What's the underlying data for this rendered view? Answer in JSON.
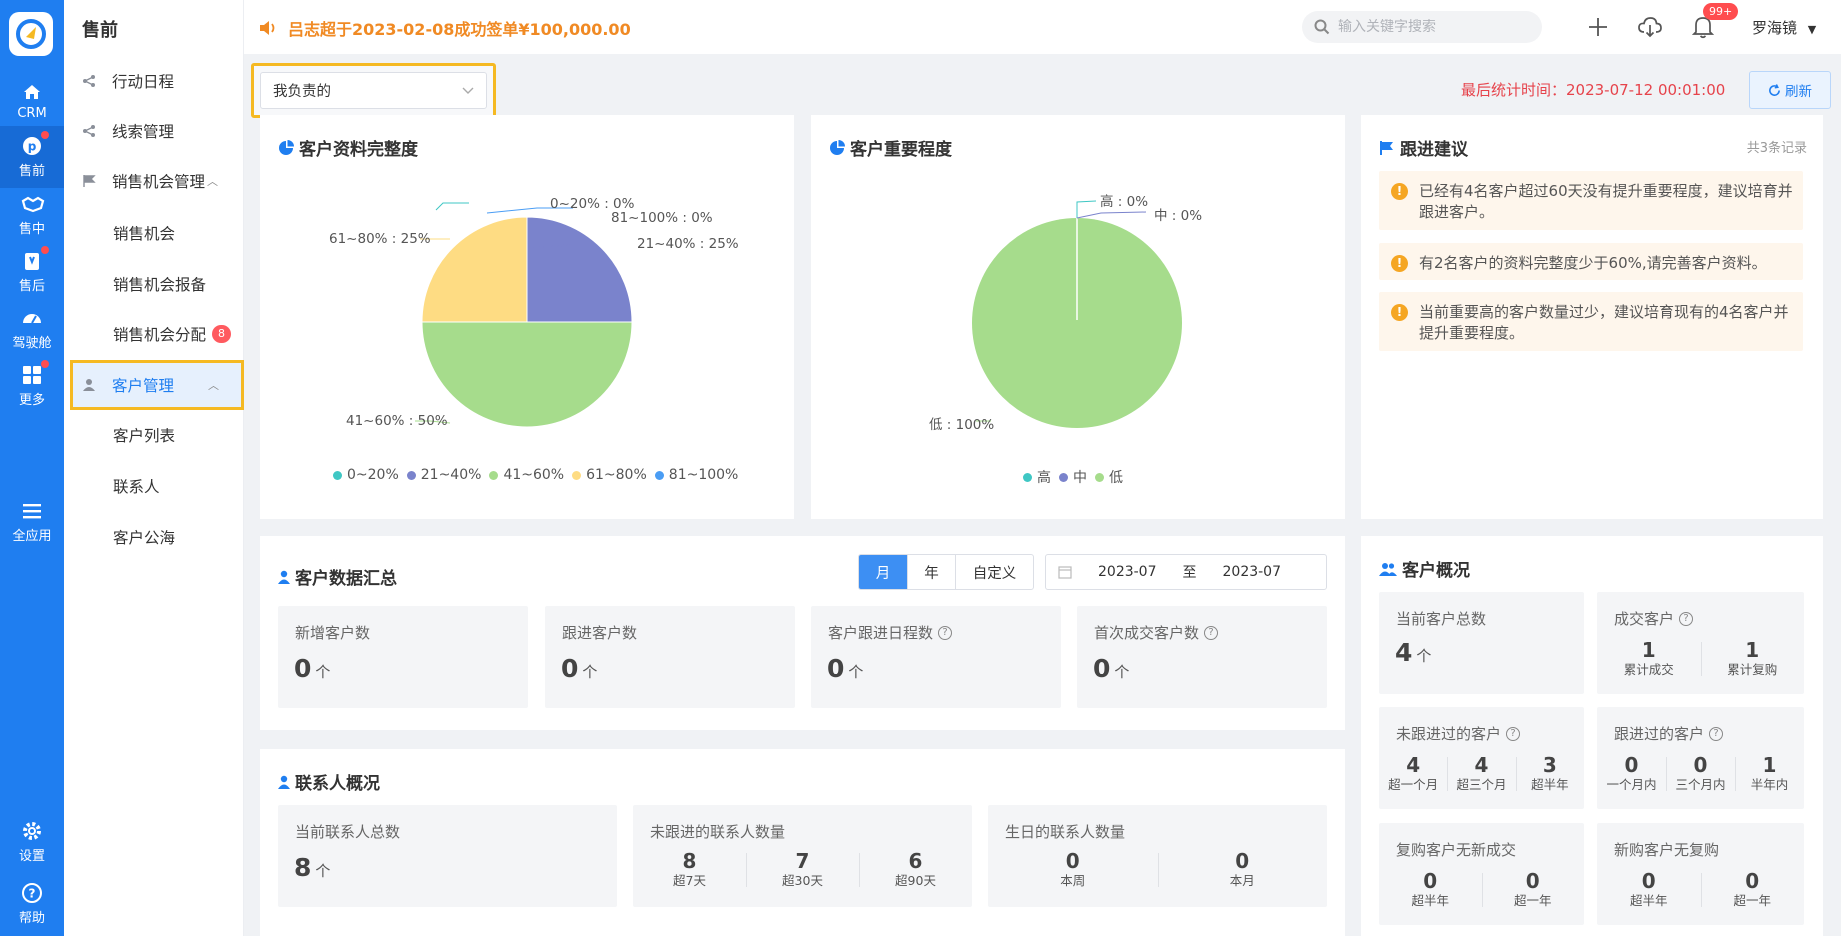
{
  "rail": {
    "items": [
      {
        "label": "CRM",
        "icon": "home-icon"
      },
      {
        "label": "售前",
        "icon": "presale-icon"
      },
      {
        "label": "售中",
        "icon": "handshake-icon"
      },
      {
        "label": "售后",
        "icon": "aftersale-icon"
      },
      {
        "label": "驾驶舱",
        "icon": "dashboard-icon"
      },
      {
        "label": "更多",
        "icon": "grid-icon"
      },
      {
        "label": "全应用",
        "icon": "menu-icon"
      }
    ],
    "settings": "设置",
    "help": "帮助"
  },
  "sidebar": {
    "title": "售前",
    "items": [
      {
        "label": "行动日程"
      },
      {
        "label": "线索管理"
      },
      {
        "label": "销售机会管理"
      },
      {
        "label": "销售机会"
      },
      {
        "label": "销售机会报备"
      },
      {
        "label": "销售机会分配",
        "badge": "8"
      },
      {
        "label": "客户管理"
      },
      {
        "label": "客户列表"
      },
      {
        "label": "联系人"
      },
      {
        "label": "客户公海"
      }
    ]
  },
  "topbar": {
    "notice": "吕志超于2023-02-08成功签单¥100,000.00",
    "search_placeholder": "输入关键字搜索",
    "bell_badge": "99+",
    "user": "罗海镜"
  },
  "filter": {
    "selected": "我负责的",
    "stat_time": "最后统计时间：2023-07-12 00:01:00",
    "refresh": "刷新"
  },
  "completeness": {
    "title": "客户资料完整度",
    "labels": [
      "0~20% : 0%",
      "81~100% : 0%",
      "21~40% : 25%",
      "61~80% : 25%",
      "41~60% : 50%"
    ],
    "legend": [
      "0~20%",
      "21~40%",
      "41~60%",
      "61~80%",
      "81~100%"
    ],
    "colors": [
      "#3fc7c4",
      "#7a83cc",
      "#a6dc8c",
      "#fedc83",
      "#4a9df4"
    ]
  },
  "importance": {
    "title": "客户重要程度",
    "labels": [
      "高 : 0%",
      "中 : 0%",
      "低 : 100%"
    ],
    "legend": [
      "高",
      "中",
      "低"
    ]
  },
  "chart_data": [
    {
      "type": "pie",
      "title": "客户资料完整度",
      "categories": [
        "0~20%",
        "21~40%",
        "41~60%",
        "61~80%",
        "81~100%"
      ],
      "values": [
        0,
        25,
        50,
        25,
        0
      ]
    },
    {
      "type": "pie",
      "title": "客户重要程度",
      "categories": [
        "高",
        "中",
        "低"
      ],
      "values": [
        0,
        0,
        100
      ]
    }
  ],
  "suggestions": {
    "title": "跟进建议",
    "count": "共3条记录",
    "items": [
      "已经有4名客户超过60天没有提升重要程度，建议培育并跟进客户。",
      "有2名客户的资料完整度少于60%,请完善客户资料。",
      "当前重要高的客户数量过少，建议培育现有的4名客户并提升重要程度。"
    ]
  },
  "summary": {
    "title": "客户数据汇总",
    "tabs": [
      "月",
      "年",
      "自定义"
    ],
    "date_from": "2023-07",
    "date_sep": "至",
    "date_to": "2023-07",
    "unit": "个",
    "boxes": [
      {
        "label": "新增客户数",
        "value": "0"
      },
      {
        "label": "跟进客户数",
        "value": "0"
      },
      {
        "label": "客户跟进日程数",
        "value": "0"
      },
      {
        "label": "首次成交客户数",
        "value": "0"
      }
    ]
  },
  "contacts": {
    "title": "联系人概况",
    "total_label": "当前联系人总数",
    "total_value": "8",
    "unfollow_label": "未跟进的联系人数量",
    "unfollow": [
      {
        "v": "8",
        "s": "超7天"
      },
      {
        "v": "7",
        "s": "超30天"
      },
      {
        "v": "6",
        "s": "超90天"
      }
    ],
    "birthday_label": "生日的联系人数量",
    "birthday": [
      {
        "v": "0",
        "s": "本周"
      },
      {
        "v": "0",
        "s": "本月"
      }
    ]
  },
  "overview": {
    "title": "客户概况",
    "total_label": "当前客户总数",
    "total_value": "4",
    "deal_label": "成交客户",
    "deal": [
      {
        "v": "1",
        "s": "累计成交"
      },
      {
        "v": "1",
        "s": "累计复购"
      }
    ],
    "nofollow_label": "未跟进过的客户",
    "nofollow": [
      {
        "v": "4",
        "s": "超一个月"
      },
      {
        "v": "4",
        "s": "超三个月"
      },
      {
        "v": "3",
        "s": "超半年"
      }
    ],
    "followed_label": "跟进过的客户",
    "followed": [
      {
        "v": "0",
        "s": "一个月内"
      },
      {
        "v": "0",
        "s": "三个月内"
      },
      {
        "v": "1",
        "s": "半年内"
      }
    ],
    "repurchase_label": "复购客户无新成交",
    "repurchase": [
      {
        "v": "0",
        "s": "超半年"
      },
      {
        "v": "0",
        "s": "超一年"
      }
    ],
    "newbuy_label": "新购客户无复购",
    "newbuy": [
      {
        "v": "0",
        "s": "超半年"
      },
      {
        "v": "0",
        "s": "超一年"
      }
    ]
  }
}
